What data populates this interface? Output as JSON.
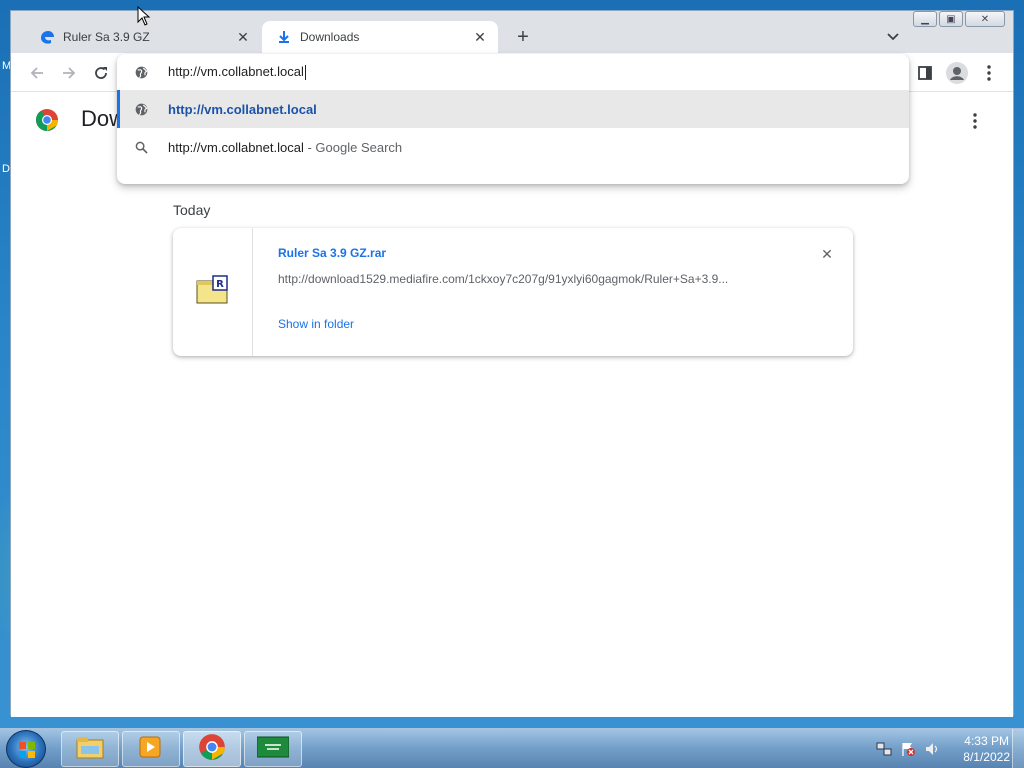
{
  "desktop": {
    "labels": [
      "M",
      "D"
    ]
  },
  "browser": {
    "tabs": [
      {
        "title": "Ruler Sa 3.9 GZ",
        "icon": "edge-style-icon",
        "active": false
      },
      {
        "title": "Downloads",
        "icon": "download-icon",
        "active": true
      }
    ],
    "new_tab_label": "+",
    "address": {
      "value": "http://vm.collabnet.local"
    },
    "suggestions": [
      {
        "text": "http://vm.collabnet.local",
        "icon": "globe-icon",
        "selected": true
      },
      {
        "text": "http://vm.collabnet.local",
        "desc": "- Google Search",
        "icon": "search-icon",
        "selected": false
      }
    ]
  },
  "downloads_page": {
    "title": "Dow",
    "section": "Today",
    "items": [
      {
        "name": "Ruler Sa 3.9 GZ.rar",
        "url": "http://download1529.mediafire.com/1ckxoy7c207g/91yxlyi60gagmok/Ruler+Sa+3.9...",
        "action": "Show in folder",
        "icon": "rar-archive-icon"
      }
    ]
  },
  "taskbar": {
    "items": [
      "windows-explorer-icon",
      "media-player-icon",
      "chrome-icon",
      "app-flag-icon"
    ],
    "clock": {
      "time": "4:33 PM",
      "date": "8/1/2022"
    }
  },
  "colors": {
    "accent": "#1a73e8",
    "tabstrip": "#dee1e6"
  }
}
